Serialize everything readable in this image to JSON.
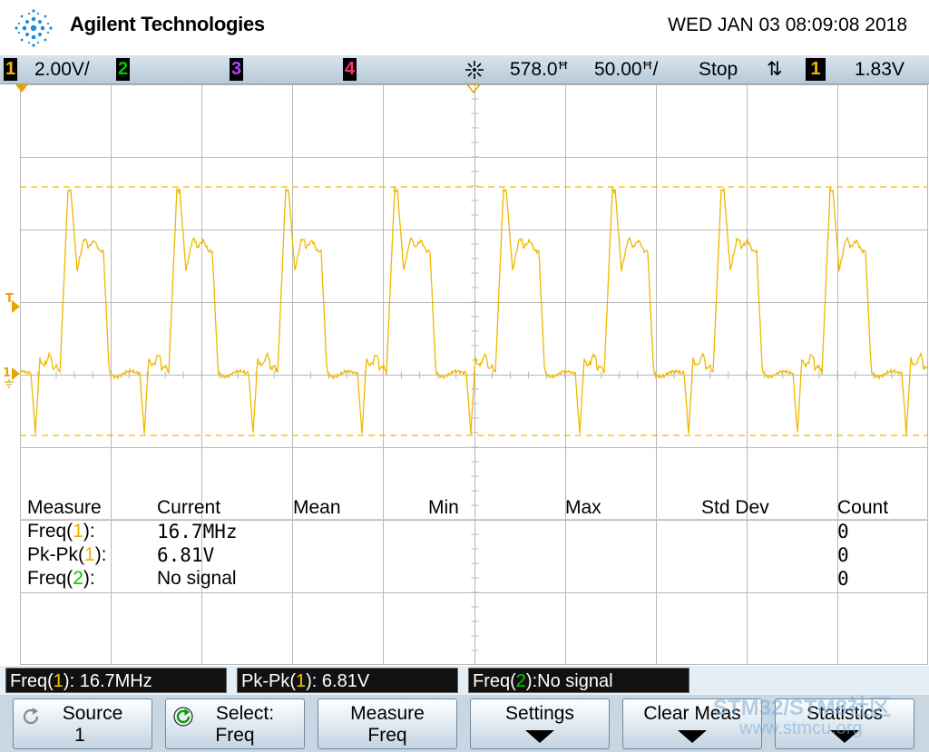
{
  "header": {
    "brand": "Agilent Technologies",
    "datetime": "WED JAN 03 08:09:08 2018"
  },
  "statusbar": {
    "ch1_label": "1",
    "ch1_scale": "2.00V/",
    "ch2_label": "2",
    "ch3_label": "3",
    "ch4_label": "4",
    "time_delay": "578.0ꟸ",
    "time_scale": "50.00ꟸ/",
    "run_state": "Stop",
    "trigger_slope": "⇅",
    "trigger_source": "1",
    "trigger_level": "1.83V"
  },
  "colors": {
    "ch1": "#f0b800",
    "ch2": "#00c800",
    "ch3": "#b040ff",
    "ch4": "#ff3070",
    "grid": "#b8b8b8"
  },
  "markers": {
    "trigger": "T",
    "ch1_ground": "1"
  },
  "measurements": {
    "headers": [
      "Measure",
      "Current",
      "Mean",
      "Min",
      "Max",
      "Std Dev",
      "Count"
    ],
    "rows": [
      {
        "name": "Freq(",
        "ch": "1",
        "close": "):",
        "current": "16.7MHz",
        "count": "0",
        "ch_color": "yel"
      },
      {
        "name": "Pk-Pk(",
        "ch": "1",
        "close": "):",
        "current": "6.81V",
        "count": "0",
        "ch_color": "yel"
      },
      {
        "name": "Freq(",
        "ch": "2",
        "close": "):",
        "current": "No signal",
        "count": "0",
        "ch_color": "grn"
      }
    ]
  },
  "readouts": [
    {
      "pre": "Freq(",
      "ch": "1",
      "post": "): 16.7MHz"
    },
    {
      "pre": "Pk-Pk(",
      "ch": "1",
      "post": "): 6.81V"
    },
    {
      "pre": "Freq(",
      "ch": "2",
      "post": "):No signal"
    }
  ],
  "softkeys": [
    {
      "line1": "Source",
      "line2": "1",
      "icon": "rotate-icon"
    },
    {
      "line1": "Select:",
      "line2": "Freq",
      "icon": "rotate-green-icon"
    },
    {
      "line1": "Measure",
      "line2": "Freq"
    },
    {
      "line1": "Settings",
      "line2": ""
    },
    {
      "line1": "Clear Meas",
      "line2": ""
    },
    {
      "line1": "Statistics",
      "line2": ""
    }
  ],
  "watermark": {
    "line1": "STM32/STM8社区",
    "line2": "www.stmcu.org"
  }
}
